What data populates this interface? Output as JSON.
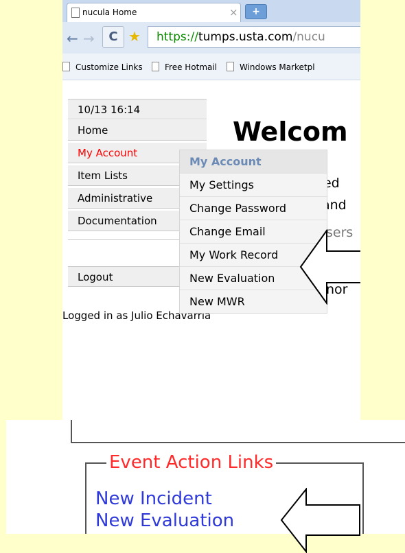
{
  "browser": {
    "tab_title": "nucula Home",
    "tab_close": "×",
    "new_tab": "+",
    "url": {
      "scheme": "https://",
      "host": "tumps.usta.com",
      "path": "/nucu"
    },
    "bookmarks": [
      "Customize Links",
      "Free Hotmail",
      "Windows Marketpl"
    ]
  },
  "page": {
    "sidebar": {
      "datetime": "10/13 16:14",
      "items": [
        "Home",
        "My Account",
        "Item Lists",
        "Administrative",
        "Documentation"
      ],
      "logout": "Logout"
    },
    "heading": "Welcom",
    "background_fragments": [
      "used",
      "and",
      "sers",
      "nor"
    ],
    "submenu": {
      "header": "My Account",
      "items": [
        "My Settings",
        "Change Password",
        "Change Email",
        "My Work Record",
        "New Evaluation",
        "New MWR"
      ]
    },
    "logged_in": "Logged in as Julio Echavarria"
  },
  "inset": {
    "legend": "Event Action Links",
    "links": [
      "New Incident",
      "New Evaluation"
    ]
  },
  "colors": {
    "background": "#ffffcc",
    "active_menu": "#ff0000",
    "link": "#2f39d9",
    "legend": "#ff2a2a",
    "submenu_header": "#6b8ab5"
  }
}
